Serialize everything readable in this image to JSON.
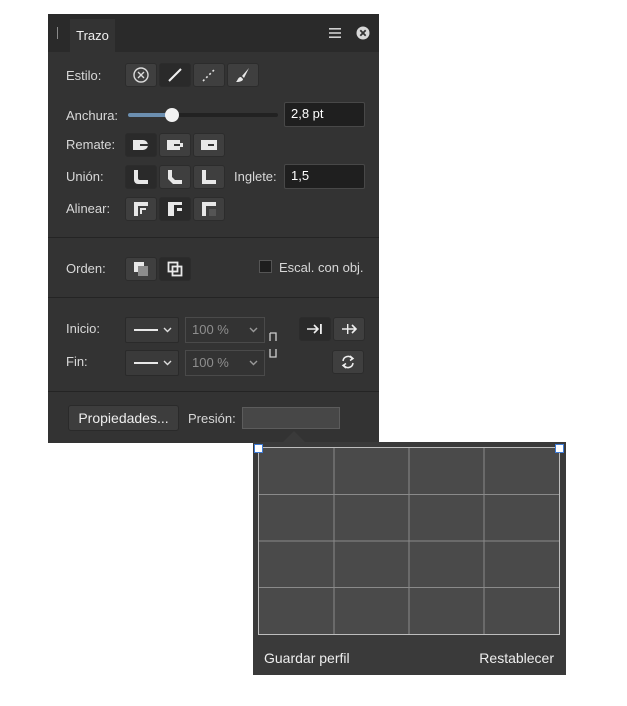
{
  "panel": {
    "tab_label": "Trazo",
    "estilo_label": "Estilo:",
    "anchura_label": "Anchura:",
    "anchura_value": "2,8 pt",
    "anchura_slider_fraction": 0.29,
    "remate_label": "Remate:",
    "union_label": "Unión:",
    "inglete_label": "Inglete:",
    "inglete_value": "1,5",
    "alinear_label": "Alinear:",
    "orden_label": "Orden:",
    "escal_label": "Escal. con obj.",
    "inicio_label": "Inicio:",
    "fin_label": "Fin:",
    "inicio_pct": "100 %",
    "fin_pct": "100 %",
    "propiedades_label": "Propiedades...",
    "presion_label": "Presión:"
  },
  "pressure_popup": {
    "guardar_label": "Guardar perfil",
    "restablecer_label": "Restablecer"
  },
  "icons": [
    "menu-icon",
    "close-icon",
    "no-style-icon",
    "solid-line-icon",
    "dashed-line-icon",
    "brush-icon",
    "butt-cap-icon",
    "round-cap-icon",
    "square-cap-icon",
    "miter-join-icon",
    "round-join-icon",
    "bevel-join-icon",
    "align-inside-icon",
    "align-center-icon",
    "align-outside-icon",
    "stroke-behind-icon",
    "stroke-front-icon",
    "swap-arrows-icon",
    "arrow-right-icon",
    "cycle-icon",
    "link-icon"
  ]
}
